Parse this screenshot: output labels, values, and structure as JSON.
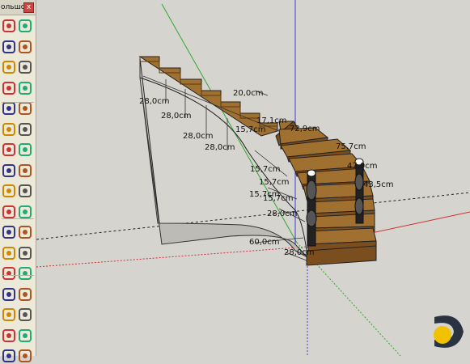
{
  "toolbar": {
    "title": "ольшо...",
    "close_label": "x",
    "tools": [
      "select-tool-icon",
      "make-component-icon",
      "paint-bucket-icon",
      "eraser-icon",
      "line-tool-icon",
      "freehand-tool-icon",
      "rectangle-tool-icon",
      "rotated-rectangle-icon",
      "circle-tool-icon",
      "polygon-tool-icon",
      "arc-tool-icon",
      "pie-tool-icon",
      "two-point-arc-icon",
      "three-point-arc-icon",
      "move-tool-icon",
      "push-pull-icon",
      "rotate-tool-icon",
      "follow-me-icon",
      "scale-tool-icon",
      "offset-tool-icon",
      "tape-measure-icon",
      "dimension-tool-icon",
      "protractor-icon",
      "text-tool-icon",
      "axes-tool-icon",
      "3d-text-icon",
      "orbit-tool-icon",
      "pan-tool-icon",
      "zoom-tool-icon",
      "zoom-window-icon",
      "zoom-extents-icon",
      "previous-view-icon",
      "walk-tool-icon",
      "look-around-icon"
    ]
  },
  "dimensions": [
    "20,0cm",
    "28,0cm",
    "28,0cm",
    "28,0cm",
    "28,0cm",
    "17,1cm",
    "15,7cm",
    "72,9cm",
    "75,7cm",
    "47,0cm",
    "43,5cm",
    "15,7cm",
    "15,7cm",
    "15,7cm",
    "15,7cm",
    "28,0cm",
    "60,0cm",
    "28,0cm"
  ],
  "colors": {
    "background": "#d6d4cf",
    "wood_top": "#a07030",
    "wood_face": "#7a4e1e",
    "axis_green": "#2fa82f",
    "axis_blue": "#3c3cd0",
    "axis_red": "#d03030"
  }
}
